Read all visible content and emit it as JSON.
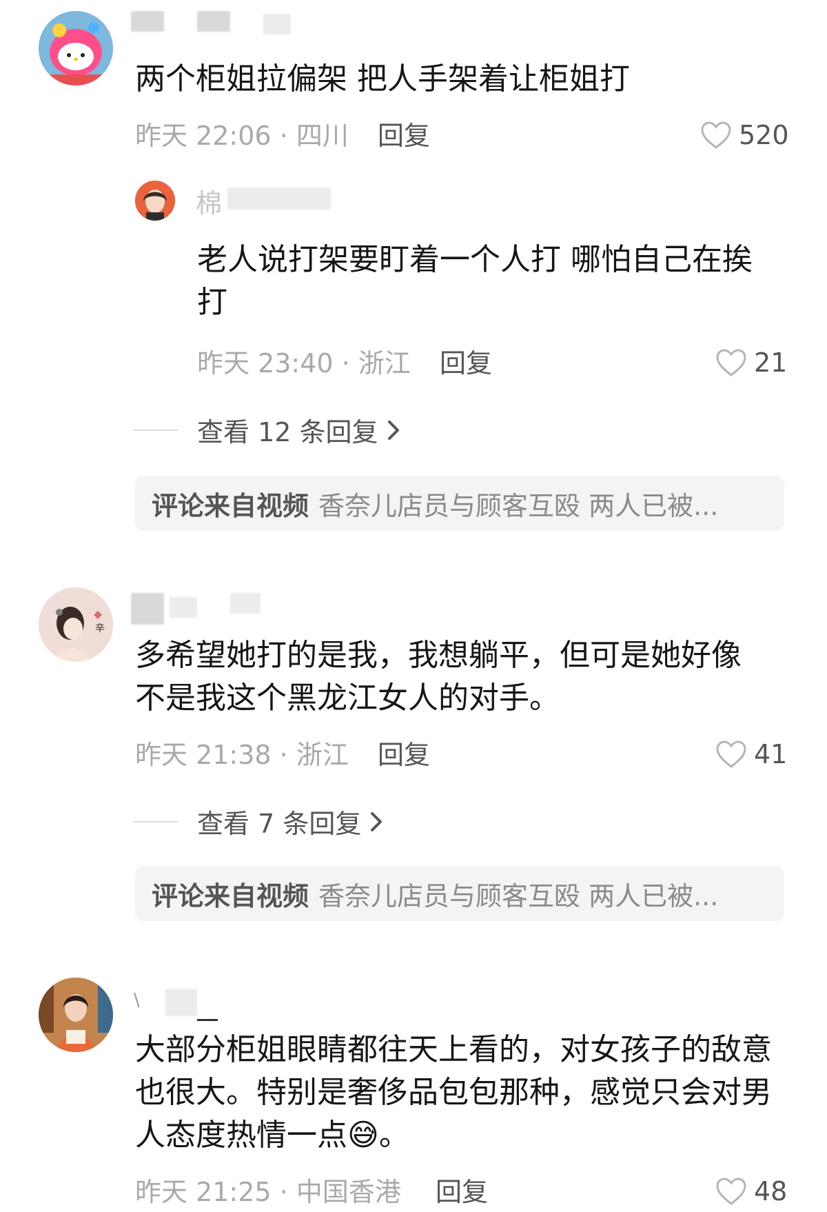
{
  "comments": [
    {
      "text": "两个柜姐拉偏架 把人手架着让柜姐打",
      "meta": "昨天 22:06 · 四川",
      "reply_label": "回复",
      "likes": "520",
      "reply": {
        "name_partial": "棉",
        "text": "老人说打架要盯着一个人打 哪怕自己在挨打",
        "meta": "昨天 23:40 · 浙江",
        "reply_label": "回复",
        "likes": "21"
      },
      "view_replies": "查看 12 条回复",
      "source_label": "评论来自视频",
      "source_title": "香奈儿店员与顾客互殴 两人已被..."
    },
    {
      "text": "多希望她打的是我，我想躺平，但可是她好像不是我这个黑龙江女人的对手。",
      "meta": "昨天 21:38 · 浙江",
      "reply_label": "回复",
      "likes": "41",
      "avatar_char": "辛",
      "view_replies": "查看 7 条回复",
      "source_label": "评论来自视频",
      "source_title": "香奈儿店员与顾客互殴 两人已被..."
    },
    {
      "name_partial": "\\",
      "text": "大部分柜姐眼睛都往天上看的，对女孩子的敌意也很大。特别是奢侈品包包那种，感觉只会对男人态度热情一点",
      "emoji": "😅",
      "text_end": "。",
      "meta": "昨天 21:25 · 中国香港",
      "reply_label": "回复",
      "likes": "48"
    }
  ],
  "colors": {
    "meta": "#a9a9a9",
    "secondary": "#555555",
    "source_bg": "#f4f4f4"
  }
}
